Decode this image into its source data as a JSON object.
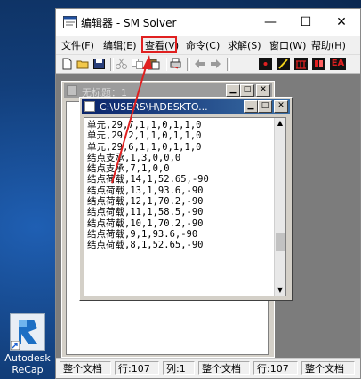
{
  "window": {
    "title": "编辑器 - SM Solver",
    "minimize_glyph": "—",
    "maximize_glyph": "☐",
    "close_glyph": "✕"
  },
  "menu": {
    "items": [
      {
        "label": "文件(F)"
      },
      {
        "label": "编辑(E)"
      },
      {
        "label": "查看(V)"
      },
      {
        "label": "命令(C)"
      },
      {
        "label": "求解(S)"
      },
      {
        "label": "窗口(W)"
      },
      {
        "label": "帮助(H)"
      }
    ]
  },
  "toolbar": {
    "icons": [
      "new-icon",
      "open-icon",
      "save-icon",
      "cut-icon",
      "copy-icon",
      "paste-icon",
      "print-icon",
      "back-icon",
      "forward-icon",
      "red-node-icon",
      "line-icon",
      "structure-icon",
      "color-icon",
      "ea-icon"
    ],
    "ea_label": "EA"
  },
  "child_untitled": {
    "title": "无标题：1"
  },
  "child_file": {
    "title": "C:\\USERS\\H\\DESKTO...",
    "lines": [
      "单元,29,7,1,1,0,1,1,0",
      "单元,29,2,1,1,0,1,1,0",
      "单元,29,6,1,1,0,1,1,0",
      "结点支承,1,3,0,0,0",
      "结点支承,7,1,0,0",
      "结点荷载,14,1,52.65,-90",
      "结点荷载,13,1,93.6,-90",
      "结点荷载,12,1,70.2,-90",
      "结点荷载,11,1,58.5,-90",
      "结点荷载,10,1,70.2,-90",
      "结点荷载,9,1,93.6,-90",
      "结点荷载,8,1,52.65,-90"
    ]
  },
  "statusbar": {
    "doc1": "整个文档",
    "line1": "行:107",
    "col1": "列:1",
    "doc2": "整个文档",
    "line2": "行:107",
    "doc3": "整个文档"
  },
  "desktop": {
    "icon_label_1": "Autodesk",
    "icon_label_2": "ReCap"
  },
  "colors": {
    "highlight": "#e02020",
    "active_title": "#0a246a"
  }
}
